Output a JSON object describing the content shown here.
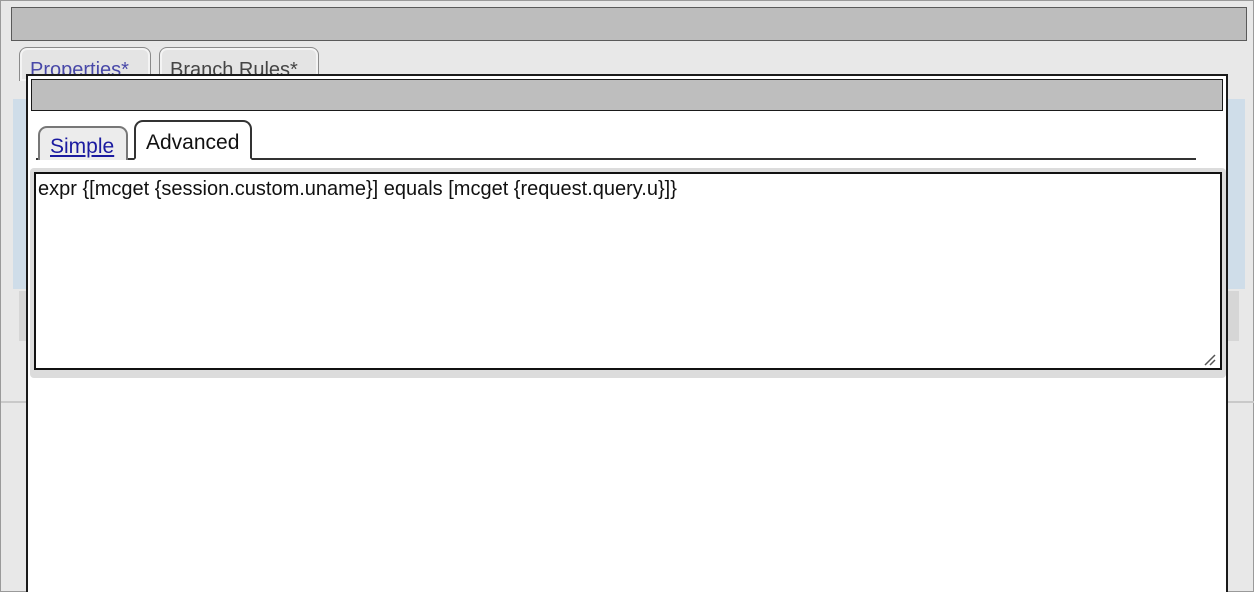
{
  "outer": {
    "tabs": [
      {
        "label": "Properties*"
      },
      {
        "label": "Branch Rules*"
      }
    ]
  },
  "modal": {
    "tabs": [
      {
        "label": "Simple"
      },
      {
        "label": "Advanced"
      }
    ],
    "expression": "expr {[mcget {session.custom.uname}] equals [mcget {request.query.u}]}"
  },
  "colors": {
    "tab_link": "#1a1aa0",
    "titlebar": "#bebebe",
    "strip": "#cfdde9"
  },
  "icons": {
    "resize": "resize-grip-icon"
  }
}
